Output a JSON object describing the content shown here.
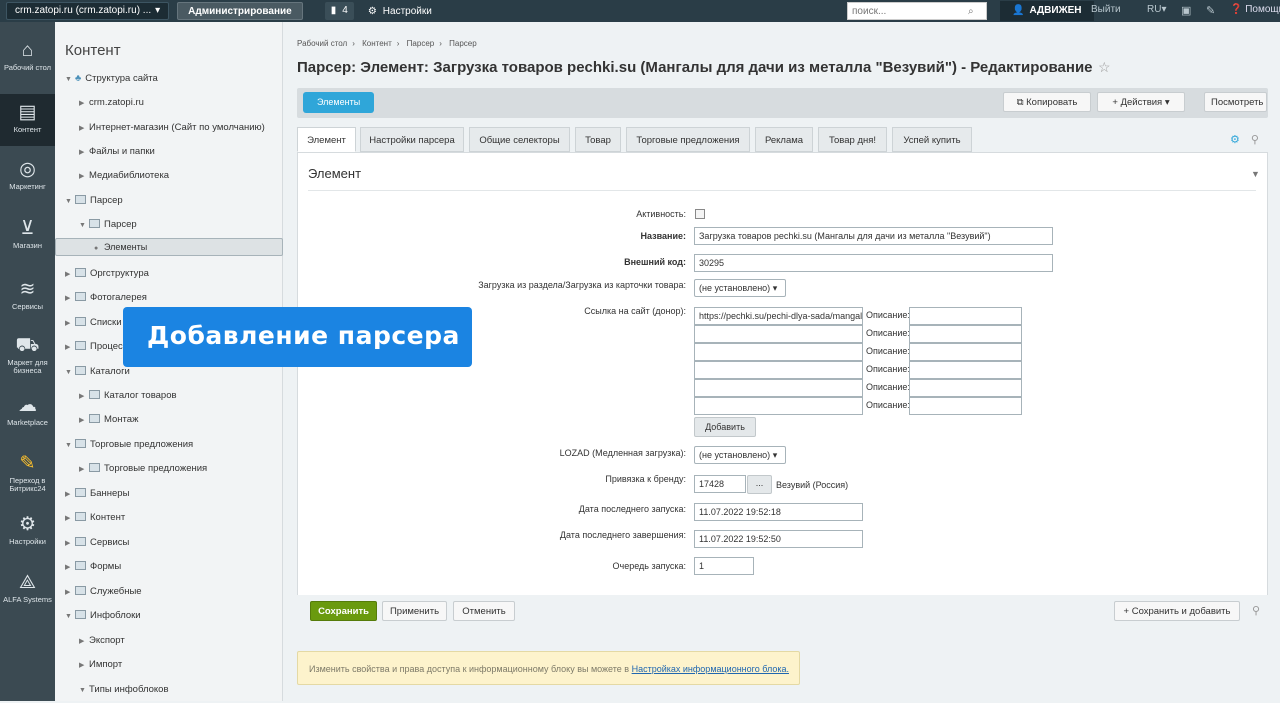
{
  "topbar": {
    "site_label": "crm.zatopi.ru (crm.zatopi.ru) ...",
    "admin_label": "Администрирование",
    "notif_count": "4",
    "settings_label": "Настройки",
    "search_placeholder": "поиск...",
    "user_label": "АДВИЖЕН",
    "exit_label": "Выйти",
    "lang_label": "RU",
    "help_label": "Помощь"
  },
  "leftnav": [
    {
      "label": "Рабочий стол",
      "icon": "home-icon"
    },
    {
      "label": "Контент",
      "icon": "document-icon"
    },
    {
      "label": "Маркетинг",
      "icon": "target-icon"
    },
    {
      "label": "Магазин",
      "icon": "basket-icon"
    },
    {
      "label": "Сервисы",
      "icon": "layers-icon"
    },
    {
      "label": "Маркет для бизнеса",
      "icon": "cart-icon"
    },
    {
      "label": "Marketplace",
      "icon": "cloud-icon"
    },
    {
      "label": "Переход в Битрикс24",
      "icon": "pencil-icon"
    },
    {
      "label": "Настройки",
      "icon": "gear-icon"
    },
    {
      "label": "ALFA Systems",
      "icon": "alfa-logo-icon"
    }
  ],
  "tree": {
    "title": "Контент",
    "items": [
      "Структура сайта",
      "crm.zatopi.ru",
      "Интернет-магазин (Сайт по умолчанию)",
      "Файлы и папки",
      "Медиабиблиотека",
      "Парсер",
      "Парсер",
      "Элементы",
      "Оргструктура",
      "Фотогалерея",
      "Списки",
      "Процессы",
      "Каталоги",
      "Каталог товаров",
      "Монтаж",
      "Торговые предложения",
      "Торговые предложения",
      "Баннеры",
      "Контент",
      "Сервисы",
      "Формы",
      "Служебные",
      "Инфоблоки",
      "Экспорт",
      "Импорт",
      "Типы инфоблоков"
    ]
  },
  "breadcrumbs": [
    "Рабочий стол",
    "Контент",
    "Парсер",
    "Парсер"
  ],
  "page_title": "Парсер: Элемент: Загрузка товаров pechki.su (Мангалы для дачи из металла \"Везувий\") - Редактирование",
  "actions": {
    "elements": "Элементы",
    "copy": "Копировать",
    "actions": "Действия",
    "view": "Посмотреть"
  },
  "tabs": [
    "Элемент",
    "Настройки парсера",
    "Общие селекторы",
    "Товар",
    "Торговые предложения",
    "Реклама",
    "Товар дня!",
    "Успей купить"
  ],
  "panel_title": "Элемент",
  "form": {
    "active_label": "Активность:",
    "name_label": "Название:",
    "name_value": "Загрузка товаров pechki.su (Мангалы для дачи из металла \"Везувий\")",
    "ext_code_label": "Внешний код:",
    "ext_code_value": "30295",
    "load_from_label": "Загрузка из раздела/Загрузка из карточки товара:",
    "load_from_value": "(не установлено)",
    "link_label": "Ссылка на сайт (донор):",
    "link_first_value": "https://pechki.su/pechi-dlya-sada/mangal",
    "desc_label": "Описание:",
    "add_label": "Добавить",
    "lozad_label": "LOZAD (Медленная загрузка):",
    "lozad_value": "(не установлено)",
    "brand_label": "Привязка к бренду:",
    "brand_value": "17428",
    "brand_btn": "...",
    "brand_name": "Везувий (Россия)",
    "last_start_label": "Дата последнего запуска:",
    "last_start_value": "11.07.2022 19:52:18",
    "last_end_label": "Дата последнего завершения:",
    "last_end_value": "11.07.2022 19:52:50",
    "queue_label": "Очередь запуска:",
    "queue_value": "1"
  },
  "footer": {
    "save": "Сохранить",
    "apply": "Применить",
    "cancel": "Отменить",
    "save_add": "Сохранить и добавить"
  },
  "notice": {
    "text": "Изменить свойства и права доступа к информационному блоку вы можете в",
    "link": "Настройках информационного блока."
  },
  "overlay_text": "Добавление парсера"
}
